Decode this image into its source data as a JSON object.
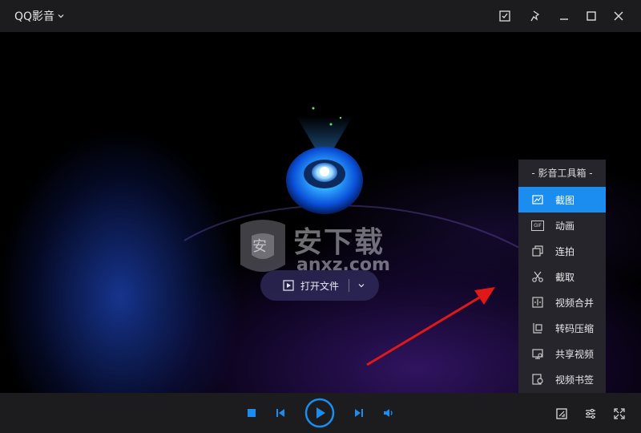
{
  "window": {
    "title": "QQ影音",
    "buttons": [
      "screenshot-icon",
      "pin-icon",
      "minimize-icon",
      "maximize-icon",
      "close-icon"
    ]
  },
  "player": {
    "open_file_label": "打开文件",
    "accent": "#1b8df1"
  },
  "toolbox": {
    "header": "- 影音工具箱 -",
    "items": [
      {
        "label": "截图",
        "icon": "screenshot-icon",
        "active": true
      },
      {
        "label": "动画",
        "icon": "gif-icon",
        "icon_text": "GIF"
      },
      {
        "label": "连拍",
        "icon": "burst-icon"
      },
      {
        "label": "截取",
        "icon": "scissors-icon"
      },
      {
        "label": "视频合并",
        "icon": "merge-icon"
      },
      {
        "label": "转码压缩",
        "icon": "transcode-icon"
      },
      {
        "label": "共享视频",
        "icon": "share-icon"
      },
      {
        "label": "视频书签",
        "icon": "bookmark-icon"
      }
    ]
  },
  "controls": {
    "buttons": [
      "stop-icon",
      "previous-icon",
      "play-icon",
      "next-icon",
      "volume-icon",
      "toolbox-icon",
      "settings-icon",
      "fullscreen-icon"
    ]
  },
  "watermark": {
    "text_top": "安下载",
    "text_bottom": "anxz.com",
    "badge": "安"
  }
}
